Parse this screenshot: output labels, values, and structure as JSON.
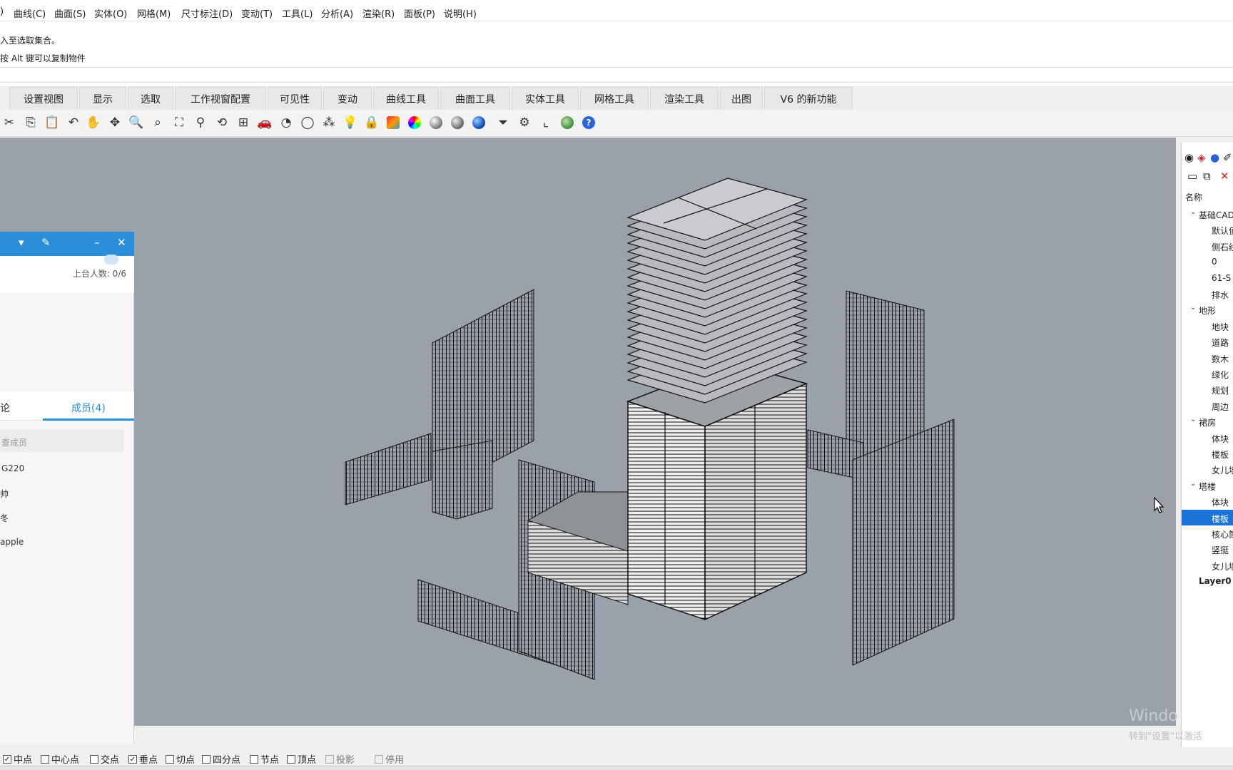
{
  "menubar": {
    "items": [
      "曲线(C)",
      "曲面(S)",
      "实体(O)",
      "网格(M)",
      "尺寸标注(D)",
      "变动(T)",
      "工具(L)",
      "分析(A)",
      "渲染(R)",
      "面板(P)",
      "说明(H)"
    ]
  },
  "command": {
    "line1": "入至选取集合。",
    "line2": "按 Alt 键可以复制物件"
  },
  "tabs": [
    "设置视图",
    "显示",
    "选取",
    "工作视窗配置",
    "可见性",
    "变动",
    "曲线工具",
    "曲面工具",
    "实体工具",
    "网格工具",
    "渲染工具",
    "出图",
    "V6 的新功能"
  ],
  "toolbar": {
    "icons": [
      "cut-icon",
      "copy-icon",
      "paste-icon",
      "undo-icon",
      "pan-hand-icon",
      "move-view-icon",
      "zoom-icon",
      "zoom-window-icon",
      "zoom-extents-icon",
      "zoom-selected-icon",
      "rotate-view-icon",
      "four-viewports-icon",
      "car-icon",
      "hide-icon",
      "show-icon",
      "select-points-icon",
      "light-bulb-icon",
      "lock-icon",
      "layer-icon",
      "color-wheel-icon",
      "shade-icon",
      "render-sphere-icon",
      "rendered-sphere-icon",
      "filter-icon",
      "gear-icon",
      "dimension-icon",
      "map-icon",
      "help-icon"
    ]
  },
  "chat": {
    "count": "上台人数: 0/6",
    "tab_discuss": "论",
    "tab_members": "成员(4)",
    "search_placeholder": "查成员",
    "members": [
      "G220",
      "帅",
      "冬",
      "apple"
    ]
  },
  "layers": {
    "header": "名称",
    "rows": [
      {
        "name": "基础CAD",
        "level": 0
      },
      {
        "name": "默认值",
        "level": 1
      },
      {
        "name": "侧石线",
        "level": 1
      },
      {
        "name": "0",
        "level": 1
      },
      {
        "name": "61-S",
        "level": 1
      },
      {
        "name": "排水",
        "level": 1
      },
      {
        "name": "地形",
        "level": 0
      },
      {
        "name": "地块",
        "level": 1
      },
      {
        "name": "道路",
        "level": 1
      },
      {
        "name": "数木",
        "level": 1
      },
      {
        "name": "绿化",
        "level": 1
      },
      {
        "name": "规划",
        "level": 1
      },
      {
        "name": "周边",
        "level": 1
      },
      {
        "name": "裙房",
        "level": 0
      },
      {
        "name": "体块",
        "level": 1
      },
      {
        "name": "楼板",
        "level": 1
      },
      {
        "name": "女儿墙",
        "level": 1
      },
      {
        "name": "塔楼",
        "level": 0
      },
      {
        "name": "体块",
        "level": 1
      },
      {
        "name": "楼板",
        "level": 1,
        "selected": true
      },
      {
        "name": "核心筒",
        "level": 1
      },
      {
        "name": "竖挺",
        "level": 1
      },
      {
        "name": "女儿墙",
        "level": 1
      },
      {
        "name": "Layer0",
        "level": 0
      }
    ]
  },
  "osnap": [
    {
      "label": "中点",
      "checked": true
    },
    {
      "label": "中心点",
      "checked": false
    },
    {
      "label": "交点",
      "checked": false
    },
    {
      "label": "垂点",
      "checked": true
    },
    {
      "label": "切点",
      "checked": false
    },
    {
      "label": "四分点",
      "checked": false
    },
    {
      "label": "节点",
      "checked": false
    },
    {
      "label": "顶点",
      "checked": false
    },
    {
      "label": "投影",
      "checked": false,
      "disabled": true
    },
    {
      "label": "停用",
      "checked": false,
      "disabled": true
    }
  ],
  "watermark": {
    "line1": "Windo",
    "line2": "转到\"设置\"以激活"
  },
  "colors": {
    "viewport_bg": "#9aa1aa",
    "accent": "#2a8fd8",
    "selected_layer": "#1a73d9"
  }
}
